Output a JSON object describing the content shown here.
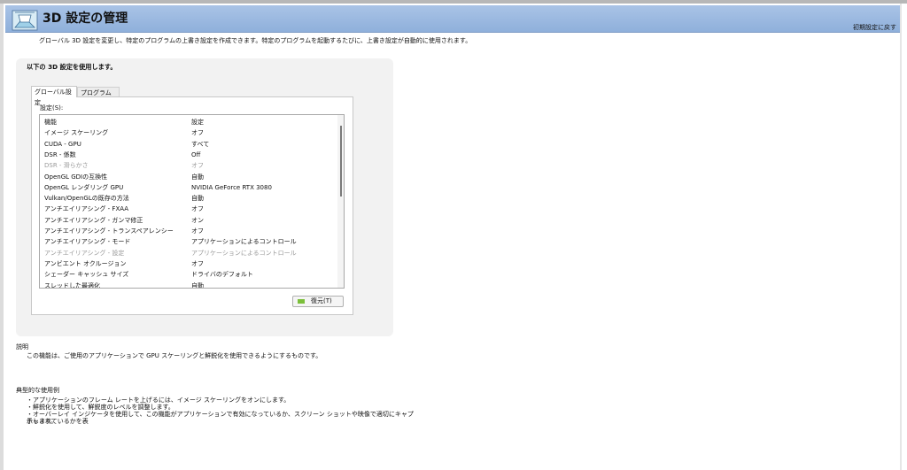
{
  "header": {
    "title": "3D 設定の管理",
    "restore_link": "初期設定に戻す"
  },
  "intro": "グローバル 3D 設定を変更し、特定のプログラムの上書き設定を作成できます。特定のプログラムを起動するたびに、上書き設定が自動的に使用されます。",
  "panel": {
    "heading": "以下の 3D 設定を使用します。",
    "tabs": [
      "グローバル設定",
      "プログラム設定"
    ],
    "settings_label": "設定(S):",
    "columns": [
      "機能",
      "設定"
    ],
    "rows": [
      {
        "feature": "イメージ スケーリング",
        "value": "オフ"
      },
      {
        "feature": "CUDA - GPU",
        "value": "すべて"
      },
      {
        "feature": "DSR - 係数",
        "value": "Off"
      },
      {
        "feature": "DSR - 滑らかさ",
        "value": "オフ"
      },
      {
        "feature": "OpenGL GDIの互換性",
        "value": "自動"
      },
      {
        "feature": "OpenGL レンダリング GPU",
        "value": "NVIDIA GeForce RTX 3080"
      },
      {
        "feature": "Vulkan/OpenGLの既存の方法",
        "value": "自動"
      },
      {
        "feature": "アンチエイリアシング - FXAA",
        "value": "オフ"
      },
      {
        "feature": "アンチエイリアシング - ガンマ修正",
        "value": "オン"
      },
      {
        "feature": "アンチエイリアシング - トランスペアレンシー",
        "value": "オフ"
      },
      {
        "feature": "アンチエイリアシング - モード",
        "value": "アプリケーションによるコントロール"
      },
      {
        "feature": "アンチエイリアシング - 設定",
        "value": "アプリケーションによるコントロール"
      },
      {
        "feature": "アンビエント オクルージョン",
        "value": "オフ"
      },
      {
        "feature": "シェーダー キャッシュ サイズ",
        "value": "ドライバのデフォルト"
      },
      {
        "feature": "スレッドした最適化",
        "value": "自動"
      }
    ],
    "restore_button": "復元(T)"
  },
  "description": {
    "heading": "説明",
    "text": "この機能は、ご使用のアプリケーションで GPU スケーリングと鮮鋭化を使用できるようにするものです。"
  },
  "usage": {
    "heading": "典型的な使用例",
    "lines": [
      "・アプリケーションのフレーム レートを上げるには、イメージ スケーリングをオンにします。",
      "・鮮鋭化を使用して、鮮鋭度のレベルを調整します。",
      "・オーバーレイ インジケータを使用して、この機能がアプリケーションで有効になっているか、スクリーン ショットや映像で適切にキャプチャされているかを表",
      "示します。"
    ]
  }
}
